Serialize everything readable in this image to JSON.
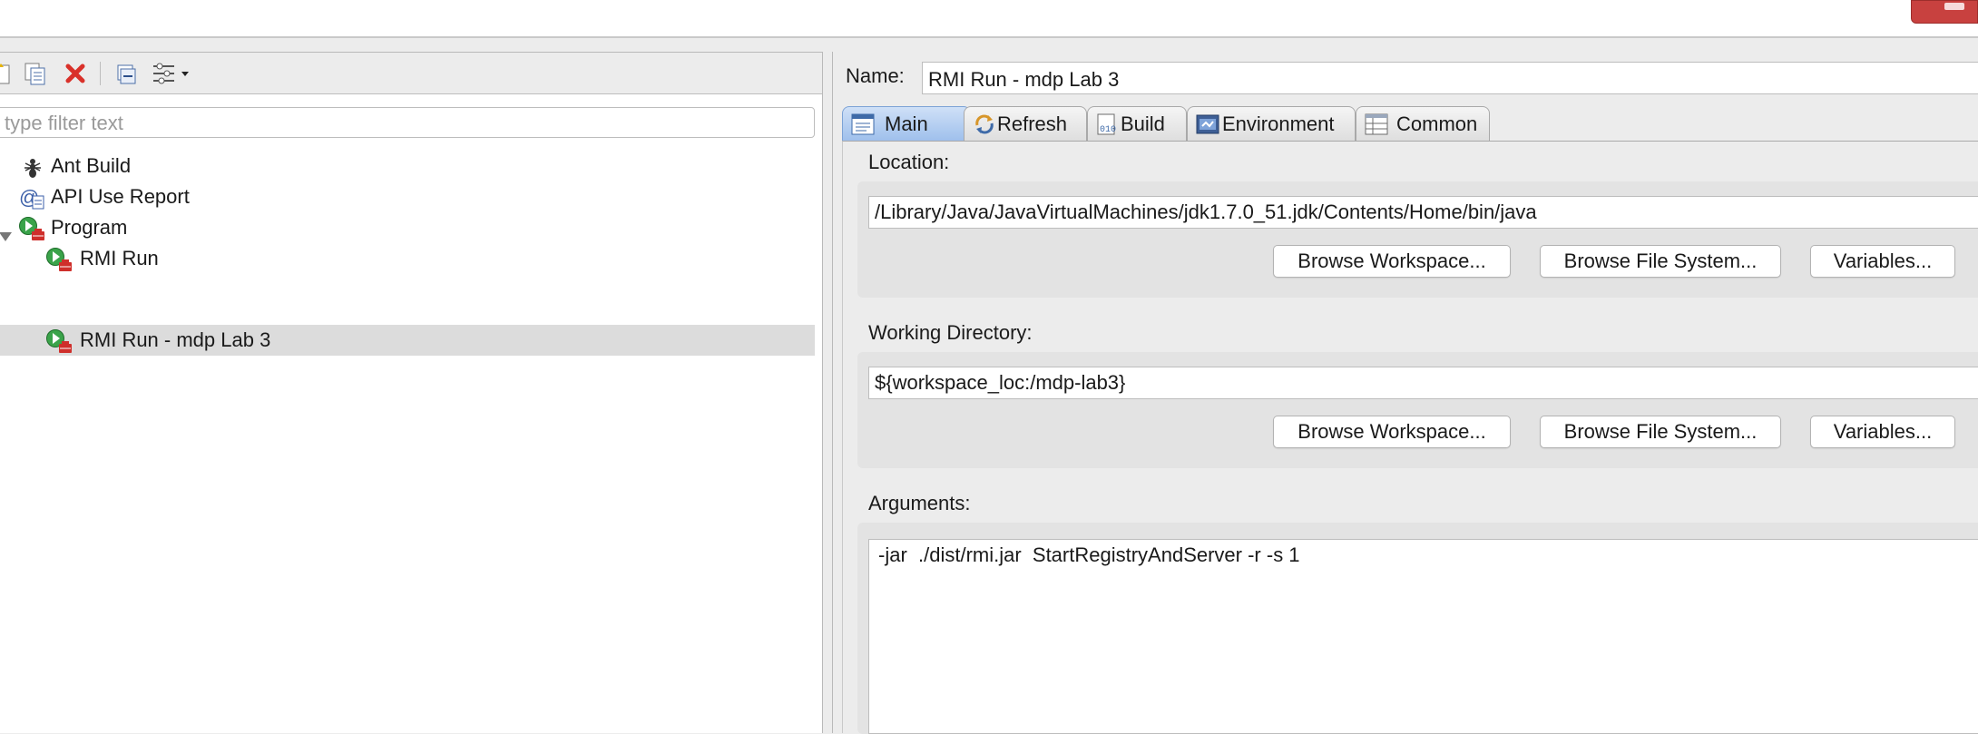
{
  "left": {
    "filter": {
      "placeholder": "type filter text"
    },
    "tree": [
      {
        "label": "Ant Build",
        "icon": "ant-icon"
      },
      {
        "label": "API Use Report",
        "icon": "api-report-icon"
      },
      {
        "label": "Program",
        "icon": "program-launch-icon",
        "expanded": true
      },
      {
        "label": "RMI Run",
        "icon": "program-launch-icon"
      },
      {
        "label": "RMI Run - mdp Lab 3",
        "icon": "program-launch-icon",
        "selected": true
      }
    ]
  },
  "config": {
    "name_label": "Name:",
    "name_value": "RMI Run - mdp Lab 3",
    "tabs": [
      {
        "label": "Main",
        "icon": "main-tab-icon",
        "active": true
      },
      {
        "label": "Refresh",
        "icon": "refresh-icon"
      },
      {
        "label": "Build",
        "icon": "build-icon"
      },
      {
        "label": "Environment",
        "icon": "environment-icon"
      },
      {
        "label": "Common",
        "icon": "common-icon"
      }
    ],
    "location": {
      "label": "Location:",
      "value": "/Library/Java/JavaVirtualMachines/jdk1.7.0_51.jdk/Contents/Home/bin/java",
      "buttons": [
        "Browse Workspace...",
        "Browse File System...",
        "Variables..."
      ]
    },
    "working_directory": {
      "label": "Working Directory:",
      "value": "${workspace_loc:/mdp-lab3}",
      "buttons": [
        "Browse Workspace...",
        "Browse File System...",
        "Variables..."
      ]
    },
    "arguments": {
      "label": "Arguments:",
      "value": "-jar  ./dist/rmi.jar  StartRegistryAndServer -r -s 1"
    }
  },
  "colors": {
    "active_tab": "#9fc0ec",
    "selection": "#dcdcdc",
    "close_button": "#c8413f",
    "delete_icon": "#d9312a",
    "launch_green": "#3aa34a"
  }
}
